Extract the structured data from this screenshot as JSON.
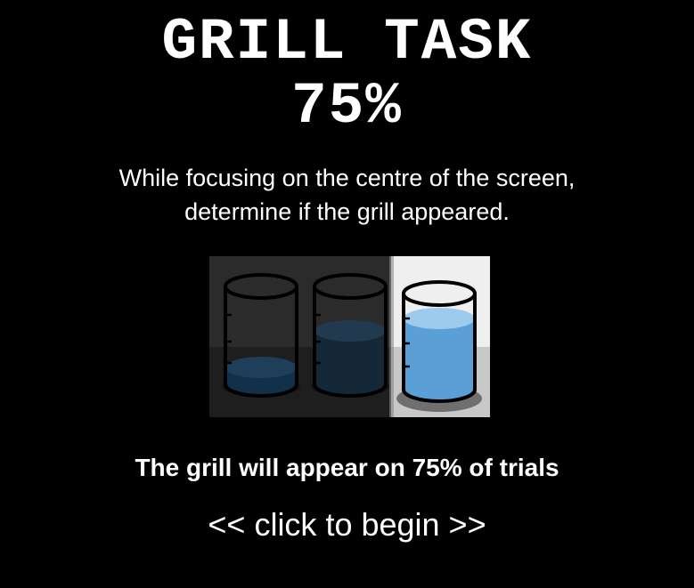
{
  "title": {
    "line1": "GRILL TASK",
    "line2": "75%"
  },
  "instructions": {
    "line1": "While focusing on the centre of the screen,",
    "line2": "determine if the grill appeared."
  },
  "illustration": {
    "icon": "beakers-illustration",
    "fill_levels": [
      0.25,
      0.5,
      0.75
    ],
    "highlighted_index": 2,
    "liquid_color": "#5a9fd6"
  },
  "note": "The grill will appear on 75% of trials",
  "begin_label": "<< click to begin >>",
  "colors": {
    "background": "#000000",
    "text": "#ffffff"
  }
}
